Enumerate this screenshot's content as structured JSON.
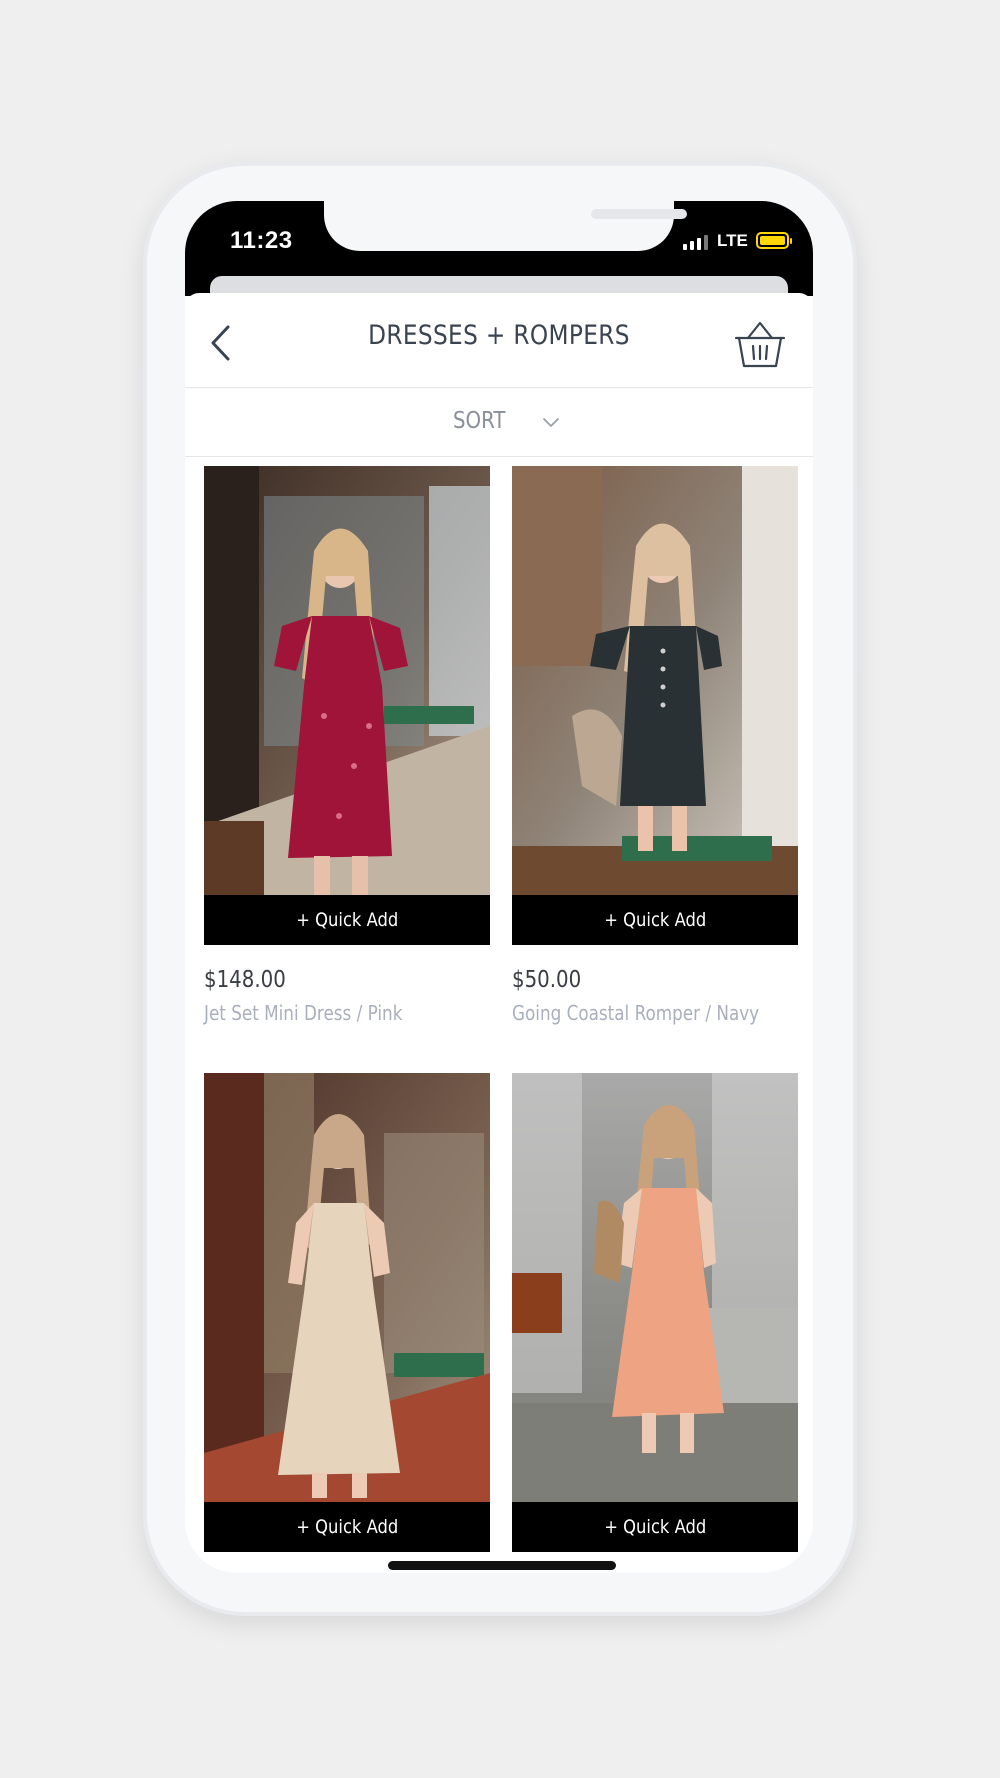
{
  "status_bar": {
    "time": "11:23",
    "network": "LTE",
    "battery_color": "#ffd60a"
  },
  "header": {
    "title": "DRESSES + ROMPERS",
    "back_icon": "chevron-left-icon",
    "cart_icon": "basket-icon"
  },
  "sort": {
    "label": "SORT",
    "icon": "chevron-down-icon"
  },
  "quick_add_label": "+ Quick Add",
  "products": [
    {
      "price": "$148.00",
      "name": "Jet Set Mini Dress / Pink",
      "dress_color": "#a0143a"
    },
    {
      "price": "$50.00",
      "name": "Going Coastal Romper / Navy",
      "dress_color": "#2a3134"
    },
    {
      "price": "",
      "name": "",
      "dress_color": "#e6d5bc"
    },
    {
      "price": "",
      "name": "",
      "dress_color": "#eea483"
    }
  ]
}
